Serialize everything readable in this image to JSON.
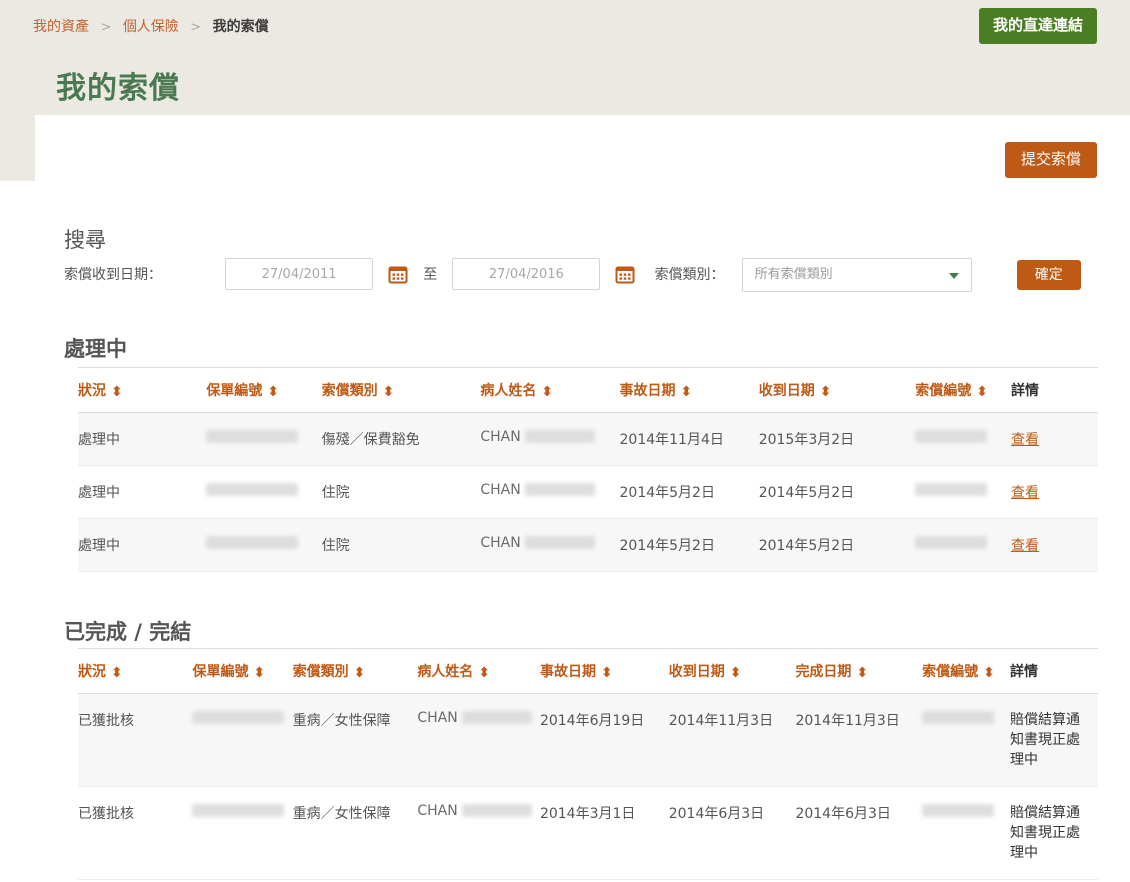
{
  "header": {
    "breadcrumb": [
      {
        "label": "我的資產",
        "link": true
      },
      {
        "label": "個人保險",
        "link": true
      },
      {
        "label": "我的索償",
        "link": false
      }
    ],
    "separator": ">",
    "page_title": "我的索償",
    "my_links_button": "我的直達連結"
  },
  "toolbar": {
    "submit_claim_button": "提交索償"
  },
  "search": {
    "heading": "搜尋",
    "date_label": "索償收到日期：",
    "date_from_placeholder": "27/04/2011",
    "date_from_value": "",
    "to_label": "至",
    "date_to_placeholder": "27/04/2016",
    "date_to_value": "",
    "calendar_icon": "calendar-icon",
    "claim_type_label": "索償類別：",
    "claim_type_selected": "所有索償類別",
    "confirm_button": "確定"
  },
  "colors": {
    "page_background": "#ece9e2",
    "accent_orange": "#bf5a16",
    "link_orange": "#c2622a",
    "title_green": "#4b7a52",
    "button_green": "#4b7d25",
    "row_alt": "#f7f7f7"
  },
  "processing": {
    "section_title": "處理中",
    "columns": [
      {
        "label": "狀況",
        "sortable": true
      },
      {
        "label": "保單編號",
        "sortable": true
      },
      {
        "label": "索償類別",
        "sortable": true
      },
      {
        "label": "病人姓名",
        "sortable": true
      },
      {
        "label": "事故日期",
        "sortable": true
      },
      {
        "label": "收到日期",
        "sortable": true
      },
      {
        "label": "索償編號",
        "sortable": true
      },
      {
        "label": "詳情",
        "sortable": false
      }
    ],
    "rows": [
      {
        "status": "處理中",
        "policy_number": "[redacted]",
        "claim_type": "傷殘／保費豁免",
        "patient_name": "CHAN",
        "patient_name_redacted": "[redacted]",
        "accident_date": "2014年11月4日",
        "received_date": "2015年3月2日",
        "claim_number": "[redacted]",
        "detail": "查看"
      },
      {
        "status": "處理中",
        "policy_number": "[redacted]",
        "claim_type": "住院",
        "patient_name": "CHAN",
        "patient_name_redacted": "[redacted]",
        "accident_date": "2014年5月2日",
        "received_date": "2014年5月2日",
        "claim_number": "[redacted]",
        "detail": "查看"
      },
      {
        "status": "處理中",
        "policy_number": "[redacted]",
        "claim_type": "住院",
        "patient_name": "CHAN",
        "patient_name_redacted": "[redacted]",
        "accident_date": "2014年5月2日",
        "received_date": "2014年5月2日",
        "claim_number": "[redacted]",
        "detail": "查看"
      }
    ]
  },
  "completed": {
    "section_title": "已完成 / 完結",
    "columns": [
      {
        "label": "狀況",
        "sortable": true
      },
      {
        "label": "保單編號",
        "sortable": true
      },
      {
        "label": "索償類別",
        "sortable": true
      },
      {
        "label": "病人姓名",
        "sortable": true
      },
      {
        "label": "事故日期",
        "sortable": true
      },
      {
        "label": "收到日期",
        "sortable": true
      },
      {
        "label": "完成日期",
        "sortable": true
      },
      {
        "label": "索償編號",
        "sortable": true
      },
      {
        "label": "詳情",
        "sortable": false
      }
    ],
    "rows": [
      {
        "status": "已獲批核",
        "policy_number": "[redacted]",
        "claim_type": "重病／女性保障",
        "patient_name": "CHAN",
        "patient_name_redacted": "[redacted]",
        "accident_date": "2014年6月19日",
        "received_date": "2014年11月3日",
        "completed_date": "2014年11月3日",
        "claim_number": "[redacted]",
        "detail": "賠償結算通知書現正處理中"
      },
      {
        "status": "已獲批核",
        "policy_number": "[redacted]",
        "claim_type": "重病／女性保障",
        "patient_name": "CHAN",
        "patient_name_redacted": "[redacted]",
        "accident_date": "2014年3月1日",
        "received_date": "2014年6月3日",
        "completed_date": "2014年6月3日",
        "claim_number": "[redacted]",
        "detail": "賠償結算通知書現正處理中"
      }
    ]
  }
}
